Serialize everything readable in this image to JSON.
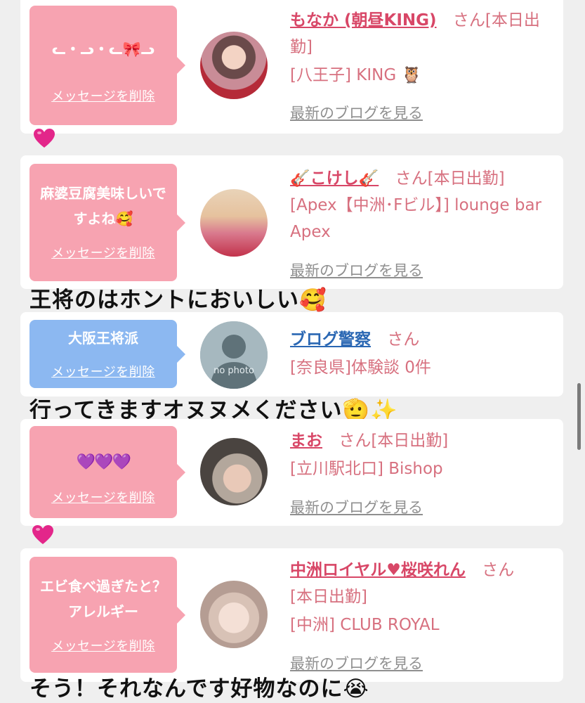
{
  "cards": [
    {
      "message": "ᓚ・ᓗ・ᓚ🎀ᓗ",
      "delete_label": "メッセージを削除",
      "name": "もなか (朝昼KING)",
      "san_status": "さん[本日出勤]",
      "shop": "[八王子] KING 🦉",
      "blog_label": "最新のブログを見る"
    },
    {
      "message": "麻婆豆腐美味しいですよね🥰",
      "delete_label": "メッセージを削除",
      "name": "🎸こけし🎸",
      "san_status": "さん[本日出勤]",
      "shop": "[Apex【中洲･Fビル】] lounge bar Apex",
      "blog_label": "最新のブログを見る"
    },
    {
      "message": "大阪王将派",
      "delete_label": "メッセージを削除",
      "name": "ブログ警察",
      "san_status": "さん",
      "shop": "[奈良県]体験談 0件",
      "avatar_text": "no photo"
    },
    {
      "message": "💜💜💜",
      "delete_label": "メッセージを削除",
      "name": "まお",
      "san_status": "さん[本日出勤]",
      "shop": "[立川駅北口] Bishop",
      "blog_label": "最新のブログを見る"
    },
    {
      "message": "エビ食べ過ぎたと？アレルギー",
      "delete_label": "メッセージを削除",
      "name": "中洲ロイヤル♥桜咲れん",
      "san_status": "さん",
      "status": "[本日出勤]",
      "shop": "[中洲] CLUB ROYAL",
      "blog_label": "最新のブログを見る"
    }
  ],
  "comments": [
    "王将のはホントにおいしい🥰",
    "行ってきますオヌヌメください🫡✨",
    "そう！それなんです好物なのに😭"
  ],
  "colors": {
    "bubble_pink": "#f7a3b1",
    "bubble_blue": "#8cb8f1",
    "name_pink": "#d84767",
    "name_blue": "#2a67b3",
    "heart": "#e3268a"
  }
}
